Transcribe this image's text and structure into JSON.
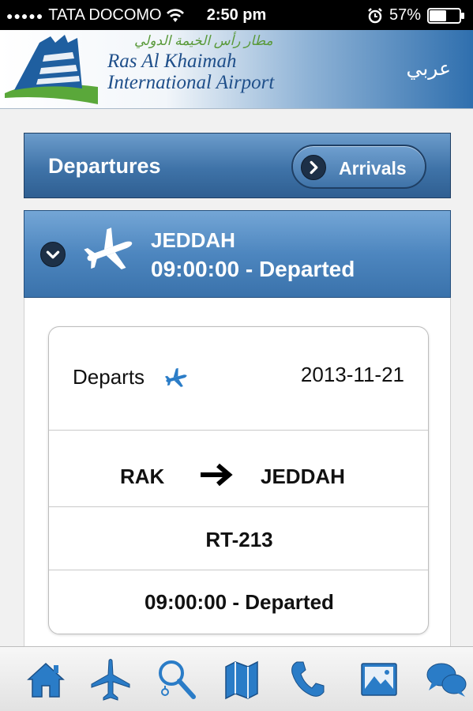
{
  "status_bar": {
    "carrier": "TATA DOCOMO",
    "time": "2:50 pm",
    "battery_percent": "57%",
    "battery_level": 0.57,
    "icons": [
      "signal-dots-icon",
      "wifi-icon",
      "alarm-icon",
      "battery-icon"
    ]
  },
  "header": {
    "logo_arabic": "مطار رأس الخيمة الدولي",
    "logo_line1": "Ras Al Khaimah",
    "logo_line2": "International Airport",
    "language_link": "عربي"
  },
  "tabs": {
    "active": "Departures",
    "toggle_label": "Arrivals"
  },
  "flight": {
    "city": "JEDDAH",
    "status_line": "09:00:00 - Departed",
    "detail": {
      "departs_label": "Departs",
      "date": "2013-11-21",
      "origin": "RAK",
      "destination": "JEDDAH",
      "flight_number": "RT-213",
      "status": "09:00:00 - Departed"
    }
  },
  "bottom_nav": {
    "items": [
      "home-icon",
      "flights-icon",
      "search-icon",
      "map-icon",
      "phone-icon",
      "gallery-icon",
      "chat-icon"
    ]
  },
  "colors": {
    "nav_blue": "#2f6fae",
    "icon_blue": "#2a7cc7",
    "logo_green": "#5a9a3b"
  }
}
